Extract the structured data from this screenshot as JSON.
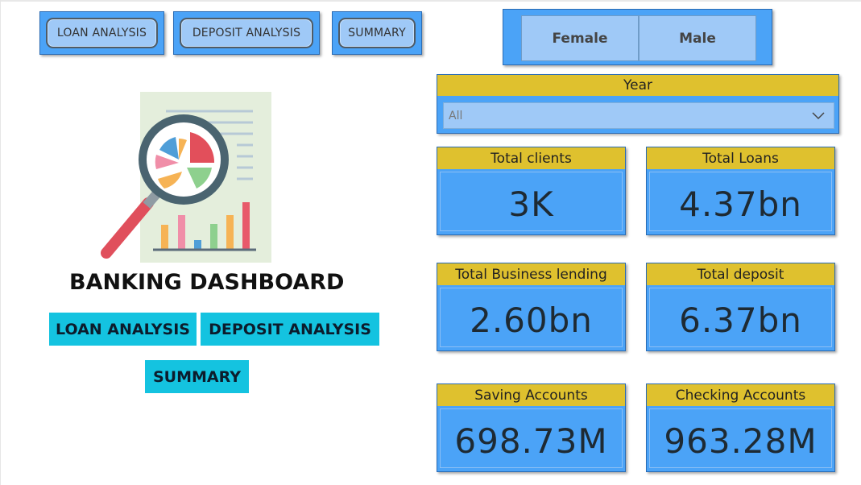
{
  "nav": {
    "loan_analysis": "LOAN ANALYSIS",
    "deposit_analysis": "DEPOSIT ANALYSIS",
    "summary": "SUMMARY"
  },
  "gender": {
    "female": "Female",
    "male": "Male"
  },
  "year": {
    "label": "Year",
    "selected": "All"
  },
  "cards": {
    "total_clients": {
      "label": "Total clients",
      "value": "3K"
    },
    "total_loans": {
      "label": "Total Loans",
      "value": "4.37bn"
    },
    "total_business_lending": {
      "label": "Total Business lending",
      "value": "2.60bn"
    },
    "total_deposit": {
      "label": "Total deposit",
      "value": "6.37bn"
    },
    "saving_accounts": {
      "label": "Saving Accounts",
      "value": "698.73M"
    },
    "checking_accounts": {
      "label": "Checking Accounts",
      "value": "963.28M"
    }
  },
  "dashboard": {
    "title": "BANKING DASHBOARD",
    "loan_analysis": "LOAN ANALYSIS",
    "deposit_analysis": "DEPOSIT ANALYSIS",
    "summary": "SUMMARY"
  },
  "colors": {
    "card_blue": "#4ba3f7",
    "header_gold": "#dfc12e",
    "teal_button": "#14c3e0",
    "pill_blue": "#9fc9f7"
  },
  "icons": {
    "logo": "magnifier-chart-report-icon",
    "dropdown": "chevron-down-icon"
  }
}
